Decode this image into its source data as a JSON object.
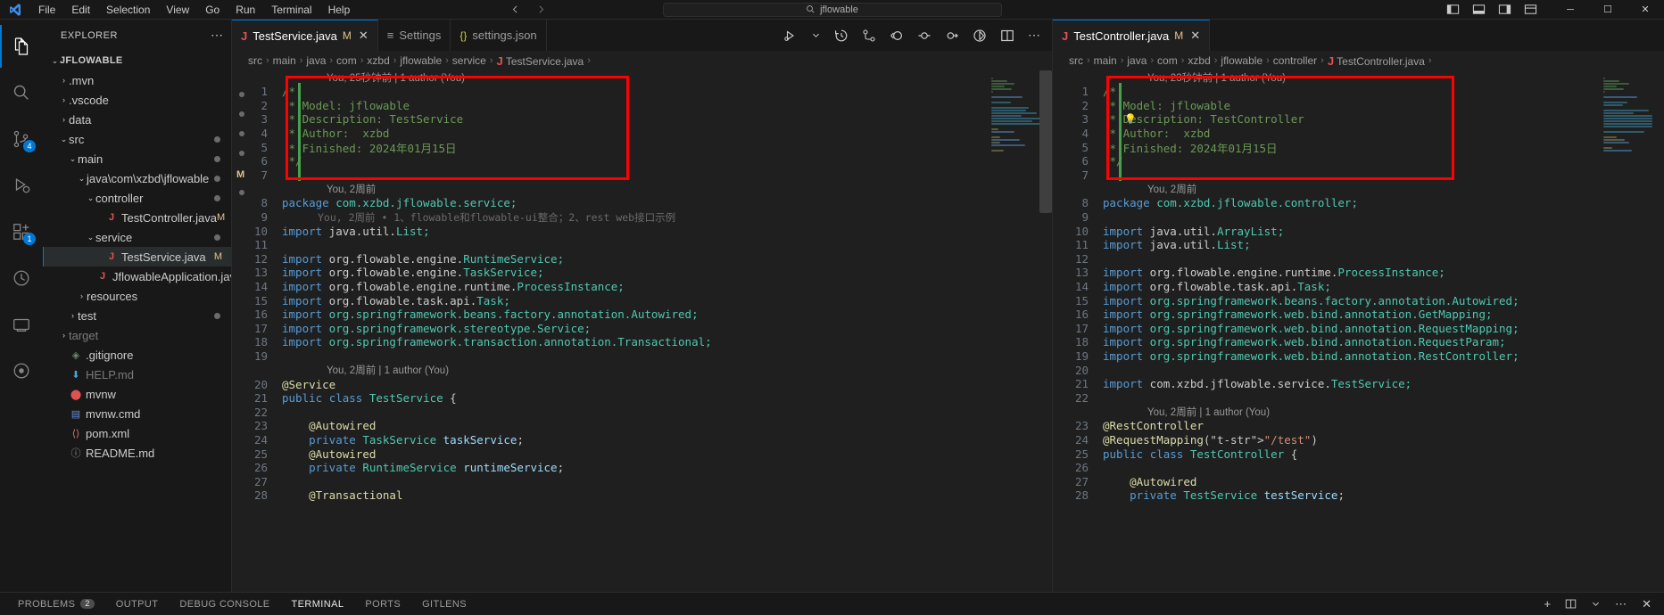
{
  "titlebar": {
    "logo_icon": "vscode-logo-icon",
    "menus": [
      "File",
      "Edit",
      "Selection",
      "View",
      "Go",
      "Run",
      "Terminal",
      "Help"
    ],
    "nav_back_icon": "arrow-left-icon",
    "nav_forward_icon": "arrow-right-icon",
    "command_center": {
      "search_icon": "search-icon",
      "text": "jflowable"
    },
    "layout_icons": [
      "toggle-primary-sidebar-icon",
      "toggle-panel-icon",
      "toggle-secondary-sidebar-icon",
      "customize-layout-icon"
    ],
    "window_controls": {
      "minimize": "─",
      "maximize": "☐",
      "close": "✕"
    }
  },
  "activitybar": {
    "items": [
      {
        "name": "explorer",
        "icon": "files-icon",
        "active": true,
        "badge": ""
      },
      {
        "name": "search",
        "icon": "search-icon",
        "active": false,
        "badge": ""
      },
      {
        "name": "source-control",
        "icon": "source-control-icon",
        "active": false,
        "badge": "4"
      },
      {
        "name": "run-and-debug",
        "icon": "debug-icon",
        "active": false,
        "badge": ""
      },
      {
        "name": "extensions",
        "icon": "extensions-icon",
        "active": false,
        "badge": "1"
      },
      {
        "name": "testing",
        "icon": "beaker-icon",
        "active": false,
        "badge": ""
      },
      {
        "name": "remote-explorer",
        "icon": "remote-icon",
        "active": false,
        "badge": ""
      },
      {
        "name": "gitlens",
        "icon": "gitlens-icon",
        "active": false,
        "badge": ""
      }
    ]
  },
  "sidebar": {
    "title": "EXPLORER",
    "more_actions_icon": "ellipsis-icon",
    "root": {
      "label": "JFLOWABLE",
      "expanded": true
    },
    "tree": [
      {
        "label": ".mvn",
        "indent": 1,
        "type": "folder",
        "expanded": false,
        "icon": "folder-icon",
        "badge": "",
        "dim": false
      },
      {
        "label": ".vscode",
        "indent": 1,
        "type": "folder",
        "expanded": false,
        "icon": "folder-icon",
        "badge": "",
        "dim": false
      },
      {
        "label": "data",
        "indent": 1,
        "type": "folder",
        "expanded": false,
        "icon": "folder-icon",
        "badge": "",
        "dim": false
      },
      {
        "label": "src",
        "indent": 1,
        "type": "folder",
        "expanded": true,
        "icon": "folder-icon",
        "badge": "dot",
        "dim": false
      },
      {
        "label": "main",
        "indent": 2,
        "type": "folder",
        "expanded": true,
        "icon": "folder-icon",
        "badge": "dot",
        "dim": false
      },
      {
        "label": "java\\com\\xzbd\\jflowable",
        "indent": 3,
        "type": "folder",
        "expanded": true,
        "icon": "folder-icon",
        "badge": "dot",
        "dim": false
      },
      {
        "label": "controller",
        "indent": 4,
        "type": "folder",
        "expanded": true,
        "icon": "folder-icon",
        "badge": "dot",
        "dim": false
      },
      {
        "label": "TestController.java",
        "indent": 5,
        "type": "java",
        "expanded": false,
        "icon": "java-icon",
        "badge": "M",
        "dim": false
      },
      {
        "label": "service",
        "indent": 4,
        "type": "folder",
        "expanded": true,
        "icon": "folder-icon",
        "badge": "dot",
        "dim": false
      },
      {
        "label": "TestService.java",
        "indent": 5,
        "type": "java",
        "expanded": false,
        "icon": "java-icon",
        "badge": "M",
        "dim": false,
        "selected": true
      },
      {
        "label": "JflowableApplication.java",
        "indent": 4,
        "type": "java",
        "expanded": false,
        "icon": "java-icon",
        "badge": "M",
        "dim": false
      },
      {
        "label": "resources",
        "indent": 3,
        "type": "folder",
        "expanded": false,
        "icon": "folder-icon",
        "badge": "",
        "dim": false
      },
      {
        "label": "test",
        "indent": 2,
        "type": "folder",
        "expanded": false,
        "icon": "folder-icon",
        "badge": "dot",
        "dim": false
      },
      {
        "label": "target",
        "indent": 1,
        "type": "folder",
        "expanded": false,
        "icon": "folder-icon",
        "badge": "",
        "dim": true
      },
      {
        "label": ".gitignore",
        "indent": 1,
        "type": "git",
        "expanded": false,
        "icon": "git-icon",
        "badge": "",
        "dim": false
      },
      {
        "label": "HELP.md",
        "indent": 1,
        "type": "md",
        "expanded": false,
        "icon": "markdown-icon",
        "badge": "",
        "dim": true
      },
      {
        "label": "mvnw",
        "indent": 1,
        "type": "bin",
        "expanded": false,
        "icon": "file-icon",
        "badge": "",
        "dim": false
      },
      {
        "label": "mvnw.cmd",
        "indent": 1,
        "type": "cmd",
        "expanded": false,
        "icon": "terminal-icon",
        "badge": "",
        "dim": false
      },
      {
        "label": "pom.xml",
        "indent": 1,
        "type": "xml",
        "expanded": false,
        "icon": "xml-icon",
        "badge": "",
        "dim": false
      },
      {
        "label": "README.md",
        "indent": 1,
        "type": "md",
        "expanded": false,
        "icon": "info-icon",
        "badge": "",
        "dim": false
      }
    ]
  },
  "editor_left": {
    "tabs": [
      {
        "label": "TestService.java",
        "icon": "java-icon",
        "modified_mark": "M",
        "active": true,
        "closable": true
      },
      {
        "label": "Settings",
        "icon": "settings-editor-icon",
        "modified_mark": "",
        "active": false,
        "closable": false
      },
      {
        "label": "settings.json",
        "icon": "json-icon",
        "modified_mark": "",
        "active": false,
        "closable": false
      }
    ],
    "tab_actions": [
      "run-or-debug-icon",
      "chevron-down-icon",
      "timeline-icon",
      "compare-changes-icon",
      "open-changes-icon",
      "previous-change-icon",
      "next-change-icon",
      "toggle-inline-view-icon",
      "split-editor-icon",
      "more-actions-icon"
    ],
    "breadcrumb": [
      "src",
      "main",
      "java",
      "com",
      "xzbd",
      "jflowable",
      "service",
      "TestService.java",
      ""
    ],
    "codelens_top": "You, 25秒钟前 | 1 author (You)",
    "codelens_8": "You, 2周前",
    "codelens_9_inline": "You, 2周前 • 1、flowable和flowable-ui整合；2、rest web接口示例",
    "codelens_20": "You, 2周前 | 1 author (You)",
    "lines": [
      {
        "n": 1,
        "text": "/*"
      },
      {
        "n": 2,
        "text": " * Model: jflowable"
      },
      {
        "n": 3,
        "text": " * Description: TestService"
      },
      {
        "n": 4,
        "text": " * Author:  xzbd"
      },
      {
        "n": 5,
        "text": " * Finished: 2024年01月15日"
      },
      {
        "n": 6,
        "text": " */"
      },
      {
        "n": 7,
        "text": ""
      },
      {
        "n": 8,
        "text": "package com.xzbd.jflowable.service;"
      },
      {
        "n": 9,
        "text": ""
      },
      {
        "n": 10,
        "text": "import java.util.List;"
      },
      {
        "n": 11,
        "text": ""
      },
      {
        "n": 12,
        "text": "import org.flowable.engine.RuntimeService;"
      },
      {
        "n": 13,
        "text": "import org.flowable.engine.TaskService;"
      },
      {
        "n": 14,
        "text": "import org.flowable.engine.runtime.ProcessInstance;"
      },
      {
        "n": 15,
        "text": "import org.flowable.task.api.Task;"
      },
      {
        "n": 16,
        "text": "import org.springframework.beans.factory.annotation.Autowired;"
      },
      {
        "n": 17,
        "text": "import org.springframework.stereotype.Service;"
      },
      {
        "n": 18,
        "text": "import org.springframework.transaction.annotation.Transactional;"
      },
      {
        "n": 19,
        "text": ""
      },
      {
        "n": 20,
        "text": "@Service"
      },
      {
        "n": 21,
        "text": "public class TestService {"
      },
      {
        "n": 22,
        "text": ""
      },
      {
        "n": 23,
        "text": "    @Autowired"
      },
      {
        "n": 24,
        "text": "    private TaskService taskService;"
      },
      {
        "n": 25,
        "text": "    @Autowired"
      },
      {
        "n": 26,
        "text": "    private RuntimeService runtimeService;"
      },
      {
        "n": 27,
        "text": ""
      },
      {
        "n": 28,
        "text": "    @Transactional"
      }
    ]
  },
  "editor_right": {
    "tabs": [
      {
        "label": "TestController.java",
        "icon": "java-icon",
        "modified_mark": "M",
        "active": true,
        "closable": true
      }
    ],
    "breadcrumb": [
      "src",
      "main",
      "java",
      "com",
      "xzbd",
      "jflowable",
      "controller",
      "TestController.java",
      ""
    ],
    "codelens_top": "You, 23秒钟前 | 1 author (You)",
    "codelens_8": "You, 2周前",
    "codelens_23": "You, 2周前 | 1 author (You)",
    "lines": [
      {
        "n": 1,
        "text": "/*"
      },
      {
        "n": 2,
        "text": " * Model: jflowable"
      },
      {
        "n": 3,
        "text": " * Description: TestController",
        "bulb": true
      },
      {
        "n": 4,
        "text": " * Author:  xzbd"
      },
      {
        "n": 5,
        "text": " * Finished: 2024年01月15日"
      },
      {
        "n": 6,
        "text": " */"
      },
      {
        "n": 7,
        "text": ""
      },
      {
        "n": 8,
        "text": "package com.xzbd.jflowable.controller;"
      },
      {
        "n": 9,
        "text": ""
      },
      {
        "n": 10,
        "text": "import java.util.ArrayList;"
      },
      {
        "n": 11,
        "text": "import java.util.List;"
      },
      {
        "n": 12,
        "text": ""
      },
      {
        "n": 13,
        "text": "import org.flowable.engine.runtime.ProcessInstance;"
      },
      {
        "n": 14,
        "text": "import org.flowable.task.api.Task;"
      },
      {
        "n": 15,
        "text": "import org.springframework.beans.factory.annotation.Autowired;"
      },
      {
        "n": 16,
        "text": "import org.springframework.web.bind.annotation.GetMapping;"
      },
      {
        "n": 17,
        "text": "import org.springframework.web.bind.annotation.RequestMapping;"
      },
      {
        "n": 18,
        "text": "import org.springframework.web.bind.annotation.RequestParam;"
      },
      {
        "n": 19,
        "text": "import org.springframework.web.bind.annotation.RestController;"
      },
      {
        "n": 20,
        "text": ""
      },
      {
        "n": 21,
        "text": "import com.xzbd.jflowable.service.TestService;"
      },
      {
        "n": 22,
        "text": ""
      },
      {
        "n": 23,
        "text": "@RestController"
      },
      {
        "n": 24,
        "text": "@RequestMapping(\"/test\")"
      },
      {
        "n": 25,
        "text": "public class TestController {"
      },
      {
        "n": 26,
        "text": ""
      },
      {
        "n": 27,
        "text": "    @Autowired"
      },
      {
        "n": 28,
        "text": "    private TestService testService;"
      }
    ]
  },
  "panel": {
    "tabs": [
      {
        "label": "PROBLEMS",
        "badge": "2",
        "active": false
      },
      {
        "label": "OUTPUT",
        "badge": "",
        "active": false
      },
      {
        "label": "DEBUG CONSOLE",
        "badge": "",
        "active": false
      },
      {
        "label": "TERMINAL",
        "badge": "",
        "active": true
      },
      {
        "label": "PORTS",
        "badge": "",
        "active": false
      },
      {
        "label": "GITLENS",
        "badge": "",
        "active": false
      }
    ],
    "actions": [
      "new-terminal-icon",
      "split-terminal-icon",
      "chevron-down-icon",
      "more-actions-icon",
      "close-panel-icon"
    ]
  },
  "colors": {
    "accent": "#0078d4",
    "annotation_box": "#ff0000",
    "modified_gutter": "#48a14d",
    "modified_badge": "#e2c08d",
    "java_icon": "#e05252",
    "comment": "#6A9955"
  }
}
